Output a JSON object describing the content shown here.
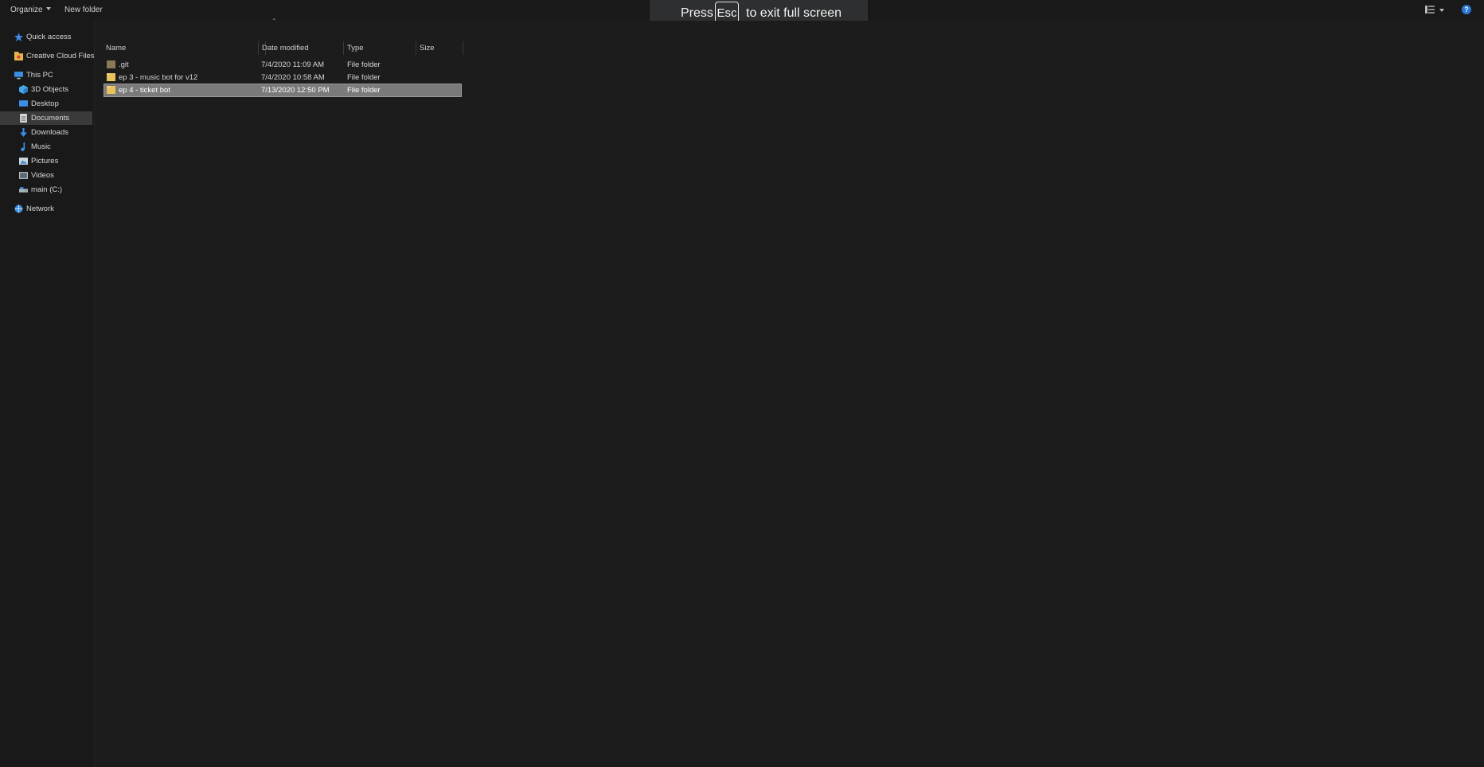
{
  "toolbar": {
    "organize_label": "Organize",
    "new_folder_label": "New folder",
    "help_label": "?"
  },
  "fullscreen_banner": {
    "press": "Press",
    "key": "Esc",
    "rest": "to exit full screen"
  },
  "nav": {
    "items": [
      {
        "label": "Quick access",
        "icon": "star-icon"
      },
      {
        "label": "Creative Cloud Files",
        "icon": "creative-cloud-icon"
      },
      {
        "label": "This PC",
        "icon": "computer-icon"
      },
      {
        "label": "3D Objects",
        "icon": "cube-icon"
      },
      {
        "label": "Desktop",
        "icon": "desktop-icon"
      },
      {
        "label": "Documents",
        "icon": "document-icon",
        "selected": true
      },
      {
        "label": "Downloads",
        "icon": "download-icon"
      },
      {
        "label": "Music",
        "icon": "music-icon"
      },
      {
        "label": "Pictures",
        "icon": "pictures-icon"
      },
      {
        "label": "Videos",
        "icon": "videos-icon"
      },
      {
        "label": "main (C:)",
        "icon": "drive-icon"
      },
      {
        "label": "Network",
        "icon": "network-icon"
      }
    ]
  },
  "columns": {
    "name": "Name",
    "date": "Date modified",
    "type": "Type",
    "size": "Size"
  },
  "files": [
    {
      "name": ".git",
      "date": "7/4/2020 11:09 AM",
      "type": "File folder",
      "size": ""
    },
    {
      "name": "ep 3 - music bot for v12",
      "date": "7/4/2020 10:58 AM",
      "type": "File folder",
      "size": ""
    },
    {
      "name": "ep 4 - ticket bot",
      "date": "7/13/2020 12:50 PM",
      "type": "File folder",
      "size": "",
      "selected": true
    }
  ],
  "colors": {
    "background": "#1c1c1c",
    "selection": "#7a7a7a",
    "folder": "#e8c25a",
    "accent": "#2a76d4"
  }
}
